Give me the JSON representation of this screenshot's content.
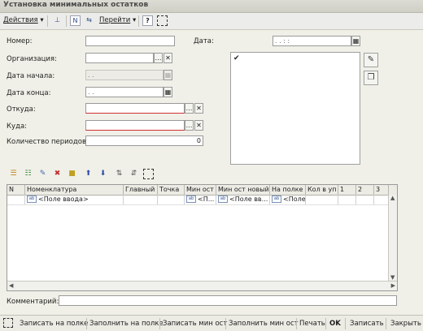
{
  "window": {
    "title": "Установка минимальных остатков"
  },
  "toolbar": {
    "actions": "Действия",
    "goto": "Перейти",
    "help": "?"
  },
  "form": {
    "number_label": "Номер:",
    "number_value": "",
    "date_label": "Дата:",
    "date_value": ".  .    :  :",
    "org_label": "Организация:",
    "org_value": "",
    "start_label": "Дата начала:",
    "start_value": ".  .",
    "end_label": "Дата конца:",
    "end_value": ".  .",
    "from_label": "Откуда:",
    "from_value": "",
    "to_label": "Куда:",
    "to_value": "",
    "periods_label": "Количество периодов:",
    "periods_value": "0",
    "list_check": "✔"
  },
  "table": {
    "columns": [
      "N",
      "Номенклатура",
      "Главный",
      "Точка",
      "Мин ост",
      "Мин ост новый",
      "На полке",
      "Кол в уп",
      "1",
      "2",
      "3"
    ],
    "row": {
      "nomenclature": "<Поле ввода>",
      "min_ost": "<П...",
      "min_ost_new": "<Поле вв...",
      "on_shelf": "<Поле..."
    }
  },
  "comment": {
    "label": "Комментарий:",
    "value": ""
  },
  "bottom": {
    "b1": "Записать на полке",
    "b2": "Заполнить на полке",
    "b3": "Записать мин ост",
    "b4": "Заполнить мин ост",
    "b5": "Печать",
    "b6": "OK",
    "b7": "Записать",
    "b8": "Закрыть"
  }
}
